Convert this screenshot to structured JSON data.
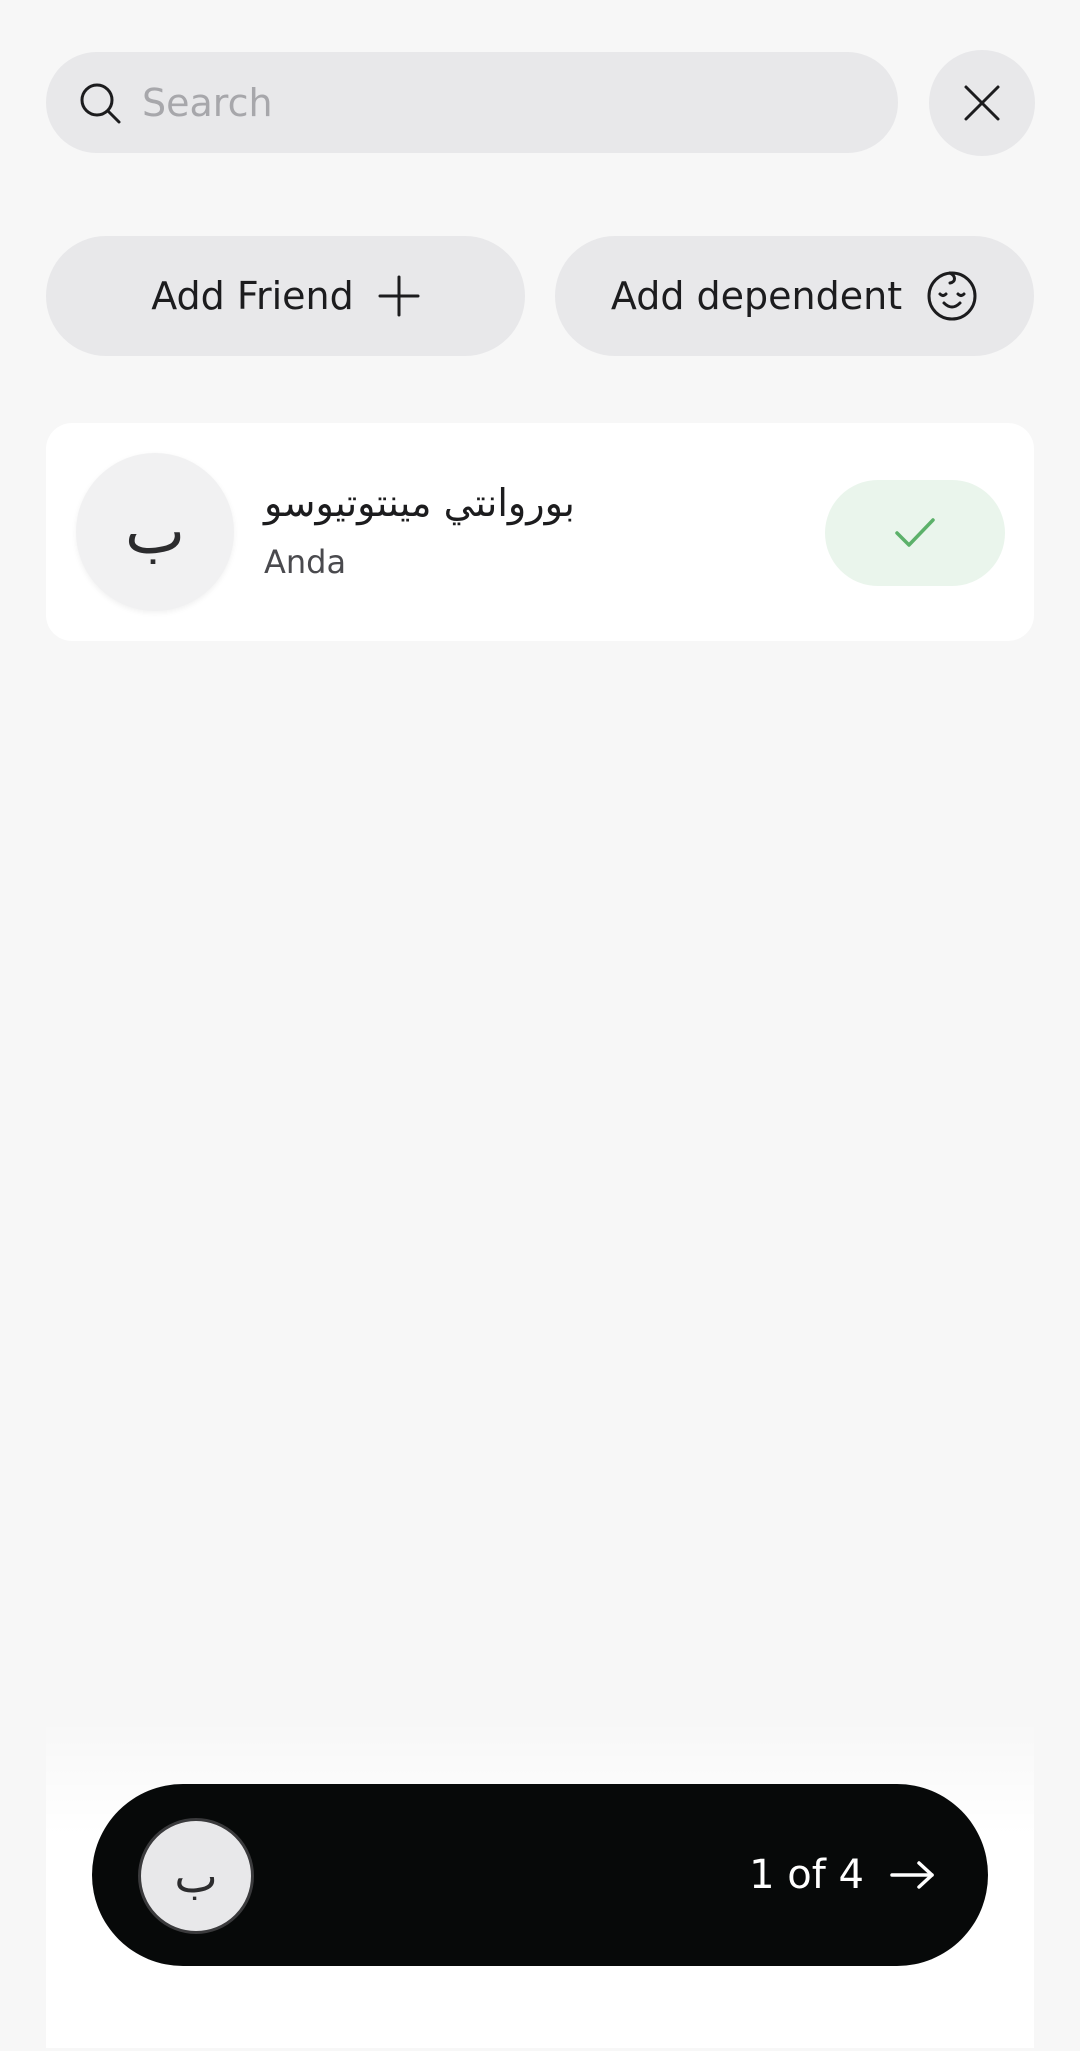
{
  "search": {
    "placeholder": "Search",
    "value": ""
  },
  "icons": {
    "search": "search-icon",
    "close": "close-icon",
    "plus": "plus-icon",
    "baby": "baby-face-icon",
    "check": "check-icon",
    "arrow": "arrow-right-icon"
  },
  "actions": {
    "add_friend_label": "Add Friend",
    "add_dependent_label": "Add dependent"
  },
  "contacts": [
    {
      "initial": "ب",
      "name": "بوروانتي مينتوتيوسو",
      "subtitle": "Anda",
      "selected": true
    }
  ],
  "bottom_bar": {
    "avatar_initial": "ب",
    "pager_text": "1 of 4"
  },
  "colors": {
    "background": "#f7f7f7",
    "pill": "#e8e8ea",
    "check_bg": "#eaf5ec",
    "check": "#5cb16a",
    "bar": "#070909"
  }
}
